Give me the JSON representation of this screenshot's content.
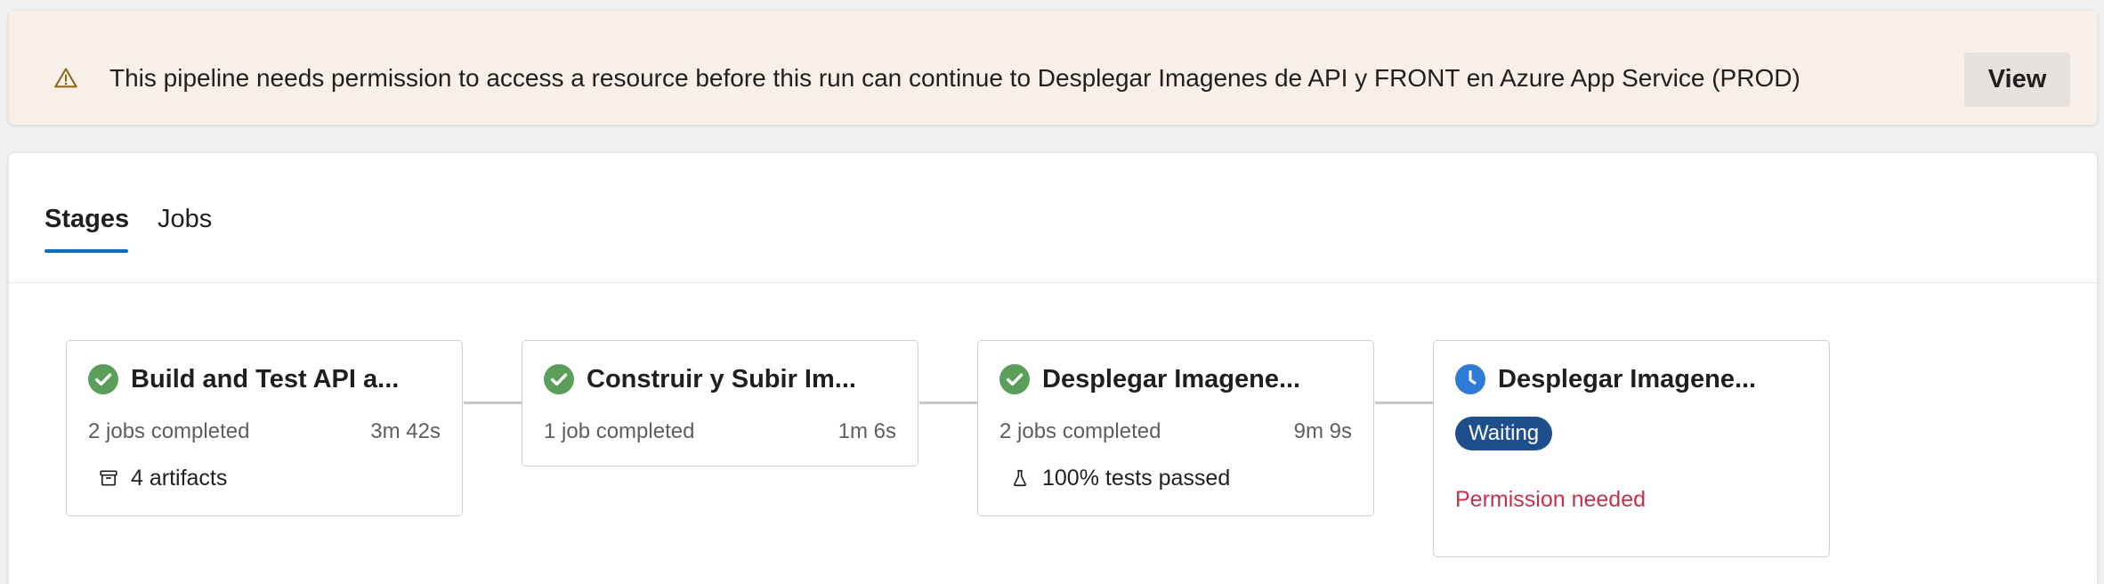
{
  "banner": {
    "icon": "warning-icon",
    "message": "This pipeline needs permission to access a resource before this run can continue to Desplegar Imagenes de API y FRONT en Azure App Service (PROD)",
    "view_label": "View"
  },
  "tabs": [
    {
      "label": "Stages",
      "active": true
    },
    {
      "label": "Jobs",
      "active": false
    }
  ],
  "stages": [
    {
      "status": "succeeded",
      "title": "Build and Test API a...",
      "jobs": "2 jobs completed",
      "duration": "3m 42s",
      "extra_icon": "artifact-box-icon",
      "extra": "4 artifacts"
    },
    {
      "status": "succeeded",
      "title": "Construir y Subir Im...",
      "jobs": "1 job completed",
      "duration": "1m 6s"
    },
    {
      "status": "succeeded",
      "title": "Desplegar Imagene...",
      "jobs": "2 jobs completed",
      "duration": "9m 9s",
      "extra_icon": "flask-icon",
      "extra": "100% tests passed"
    },
    {
      "status": "waiting",
      "title": "Desplegar Imagene...",
      "badge": "Waiting",
      "note": "Permission needed"
    }
  ],
  "colors": {
    "success": "#5a9e5a",
    "waiting": "#2f7bd8",
    "badge": "#1f4e8c",
    "error_text": "#c4314b",
    "accent": "#0f6cbd",
    "warning_icon": "#8a6a1e"
  }
}
